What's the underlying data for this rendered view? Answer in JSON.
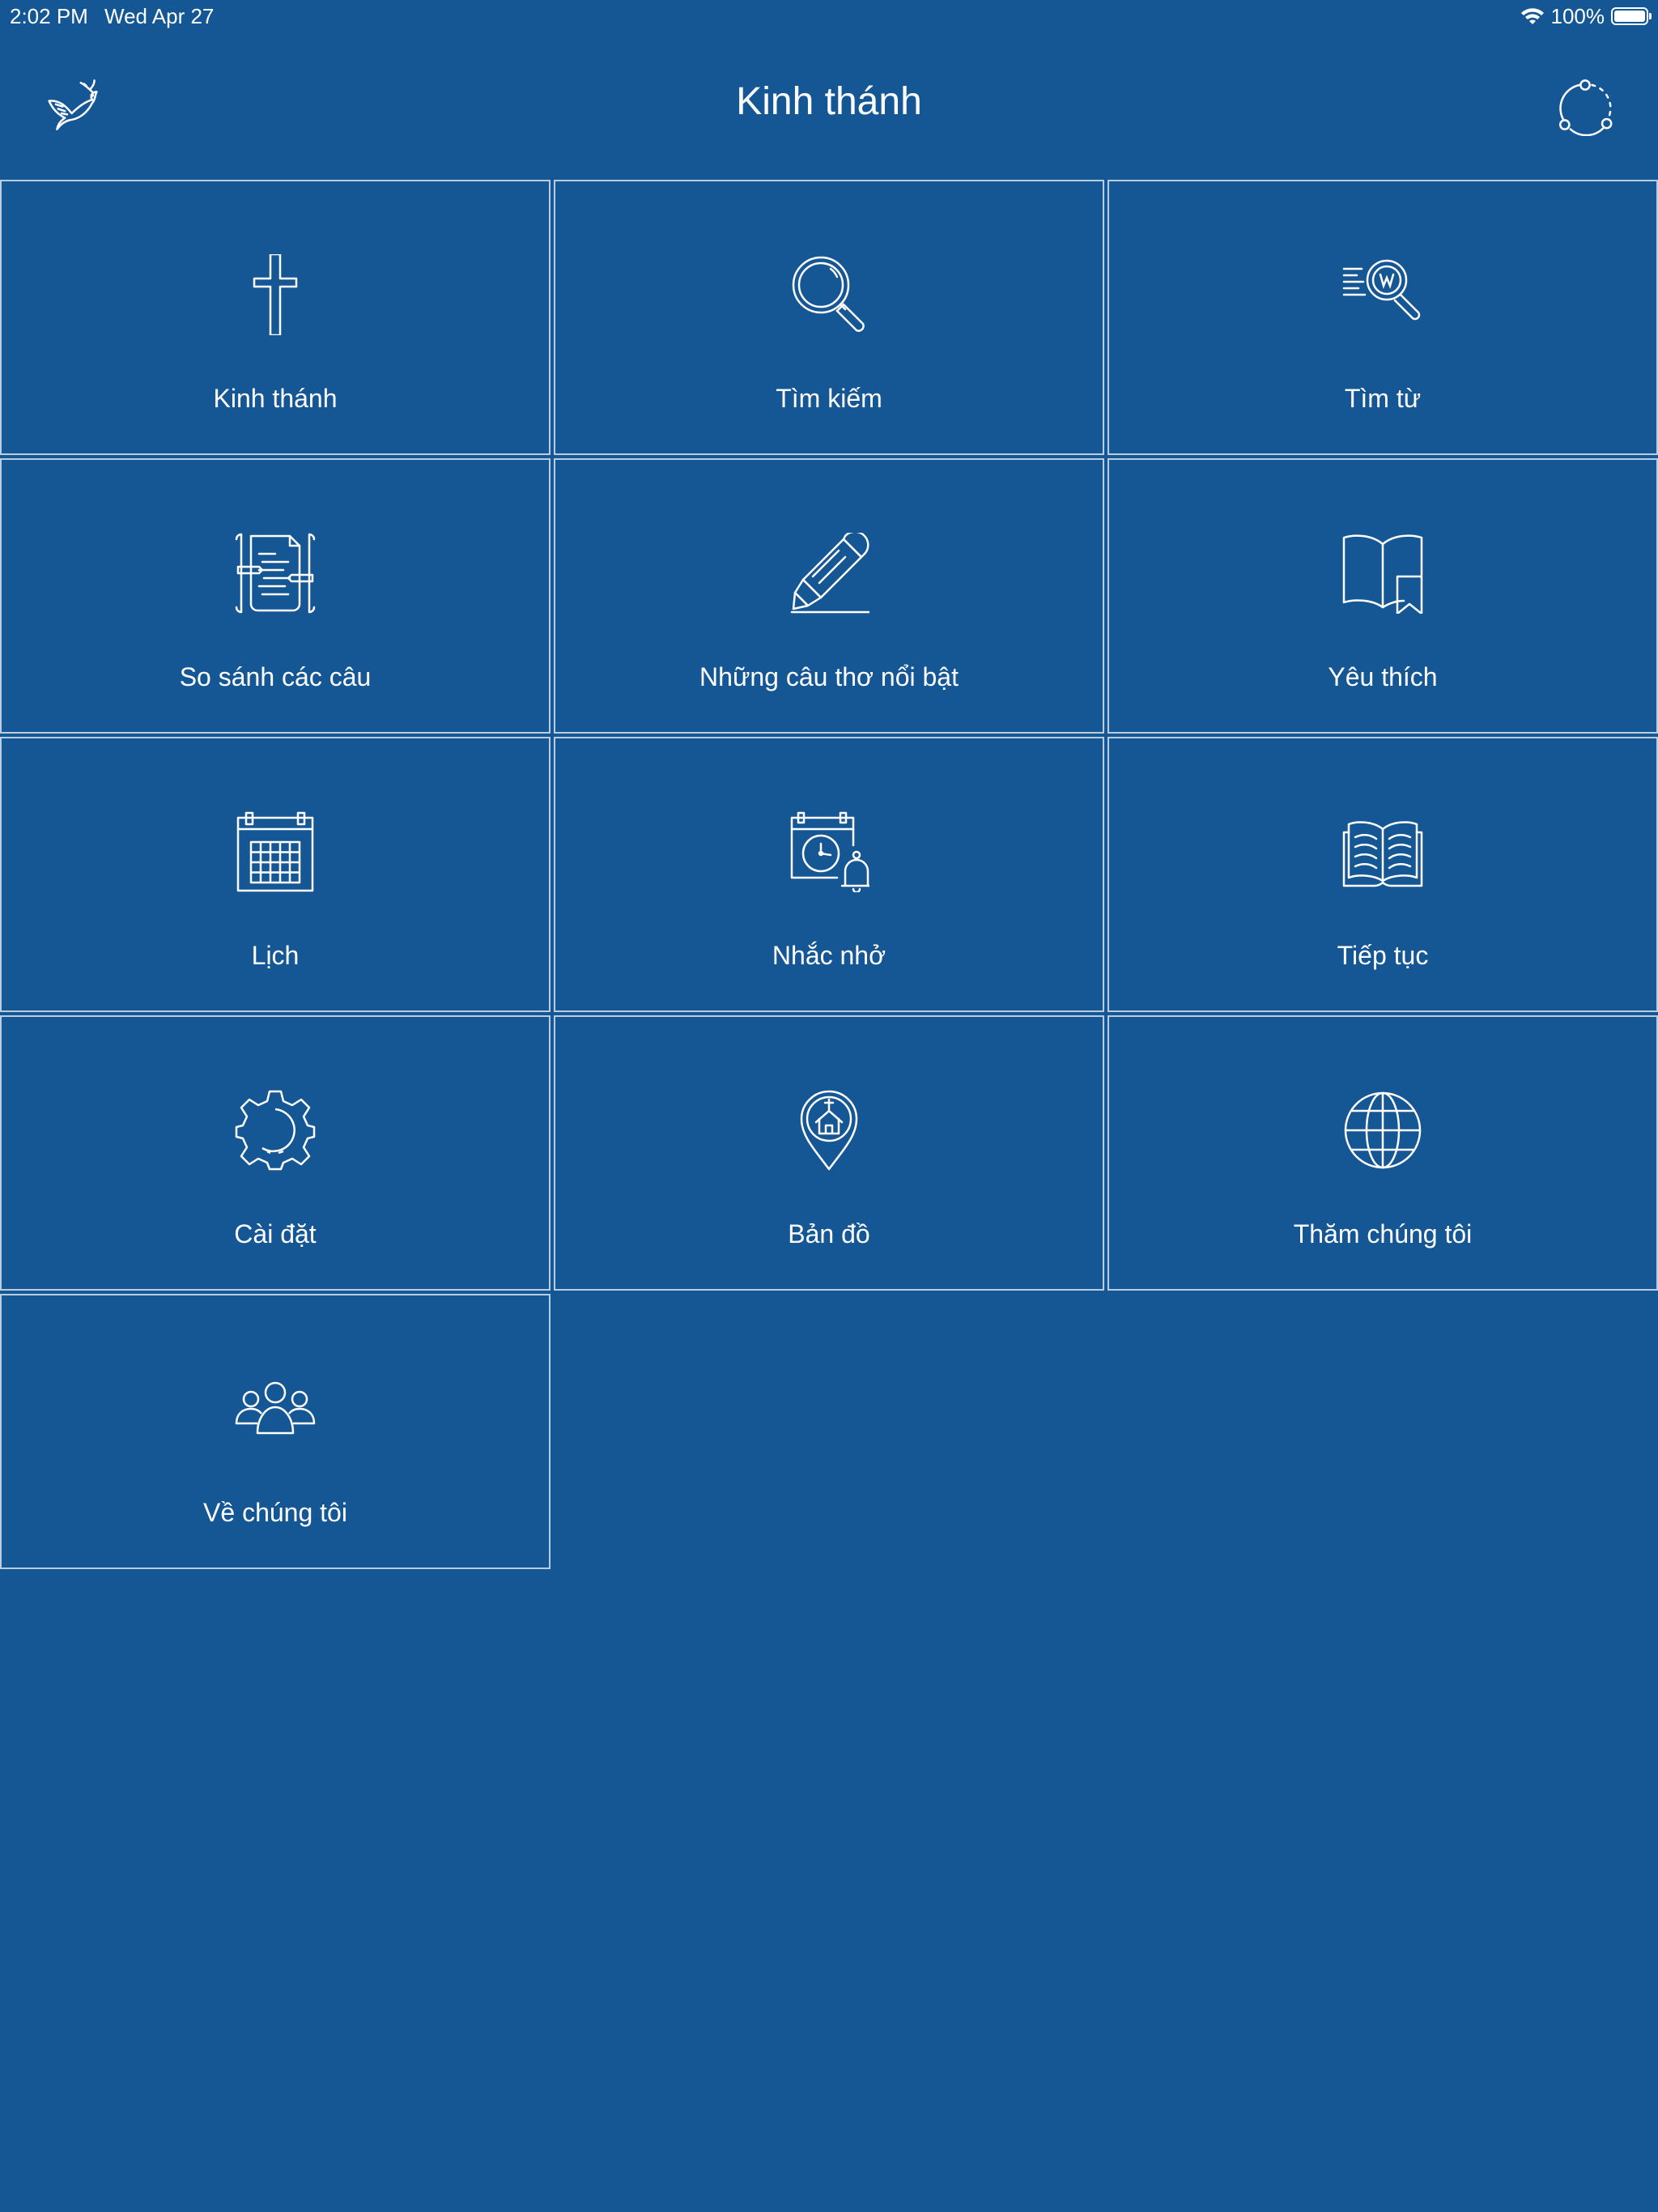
{
  "status": {
    "time": "2:02 PM",
    "date": "Wed Apr 27",
    "battery": "100%",
    "battery_level": 1.0
  },
  "header": {
    "title": "Kinh thánh",
    "left_icon": "dove-icon",
    "right_icon": "sync-icon"
  },
  "tiles": [
    {
      "label": "Kinh thánh",
      "icon": "cross-icon"
    },
    {
      "label": "Tìm kiếm",
      "icon": "search-icon"
    },
    {
      "label": "Tìm từ",
      "icon": "word-search-icon"
    },
    {
      "label": "So sánh các câu",
      "icon": "compare-verses-icon"
    },
    {
      "label": "Những câu thơ nổi bật",
      "icon": "highlight-pen-icon"
    },
    {
      "label": "Yêu thích",
      "icon": "bookmark-book-icon"
    },
    {
      "label": "Lịch",
      "icon": "calendar-icon"
    },
    {
      "label": "Nhắc nhở",
      "icon": "reminder-icon"
    },
    {
      "label": "Tiếp tục",
      "icon": "open-book-icon"
    },
    {
      "label": "Cài đặt",
      "icon": "gear-icon"
    },
    {
      "label": "Bản đồ",
      "icon": "map-pin-church-icon"
    },
    {
      "label": "Thăm chúng tôi",
      "icon": "globe-icon"
    },
    {
      "label": "Về chúng tôi",
      "icon": "people-icon"
    }
  ],
  "colors": {
    "background": "#155795",
    "tile_border": "#b9cce0",
    "text": "#ffffff"
  }
}
